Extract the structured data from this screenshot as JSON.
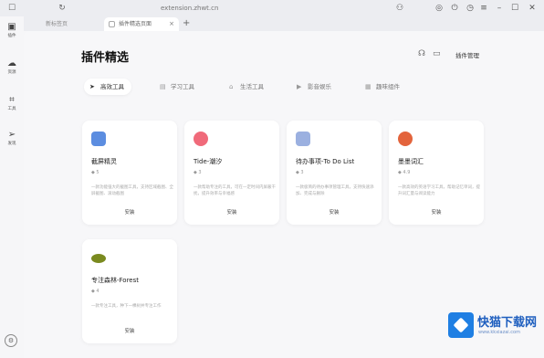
{
  "browser": {
    "url": "extension.zhwt.cn",
    "tabs": [
      {
        "label": "新标签页"
      },
      {
        "label": "插件精选页面"
      }
    ],
    "new_tab": "+",
    "close": "×"
  },
  "sidebar": {
    "items": [
      {
        "label": "插件",
        "icon": "extension-icon"
      },
      {
        "label": "资源",
        "icon": "cloud-icon"
      },
      {
        "label": "工具",
        "icon": "scan-icon"
      },
      {
        "label": "发现",
        "icon": "send-icon"
      }
    ]
  },
  "page": {
    "title": "插件精选",
    "manage_link": "插件管理"
  },
  "categories": [
    {
      "label": "高效工具",
      "active": true
    },
    {
      "label": "学习工具",
      "active": false
    },
    {
      "label": "生活工具",
      "active": false
    },
    {
      "label": "影音娱乐",
      "active": false
    },
    {
      "label": "趣味组件",
      "active": false
    }
  ],
  "cards": [
    {
      "name": "截屏精灵",
      "meta": "◆ 5",
      "desc": "一款功能强大的截图工具，支持区域截图、全屏截图、滚动截图",
      "action": "安装",
      "color": "#5c8de0"
    },
    {
      "name": "Tide-潮汐",
      "meta": "◆ 3",
      "desc": "一款帮助专注的工具，可在一定时间内屏蔽干扰，提升效率与幸福感",
      "action": "安装",
      "color": "#f06a7a"
    },
    {
      "name": "待办事项-To Do List",
      "meta": "◆ 3",
      "desc": "一款极简的待办事项管理工具，支持快速添加、完成与删除",
      "action": "安装",
      "color": "#9bb0e0"
    },
    {
      "name": "墨墨词汇",
      "meta": "◆ 4.9",
      "desc": "一款高效的英语学习工具，帮助记忆单词，提升词汇量与阅读能力",
      "action": "安装",
      "color": "#e3643c"
    },
    {
      "name": "专注森林-Forest",
      "meta": "◆ 4",
      "desc": "一款专注工具，种下一棵树并专注工作",
      "action": "安装",
      "color": "#7a8a1f"
    }
  ],
  "watermark": {
    "title": "快猫下载网",
    "subtitle": "www.kkxiazai.com"
  }
}
